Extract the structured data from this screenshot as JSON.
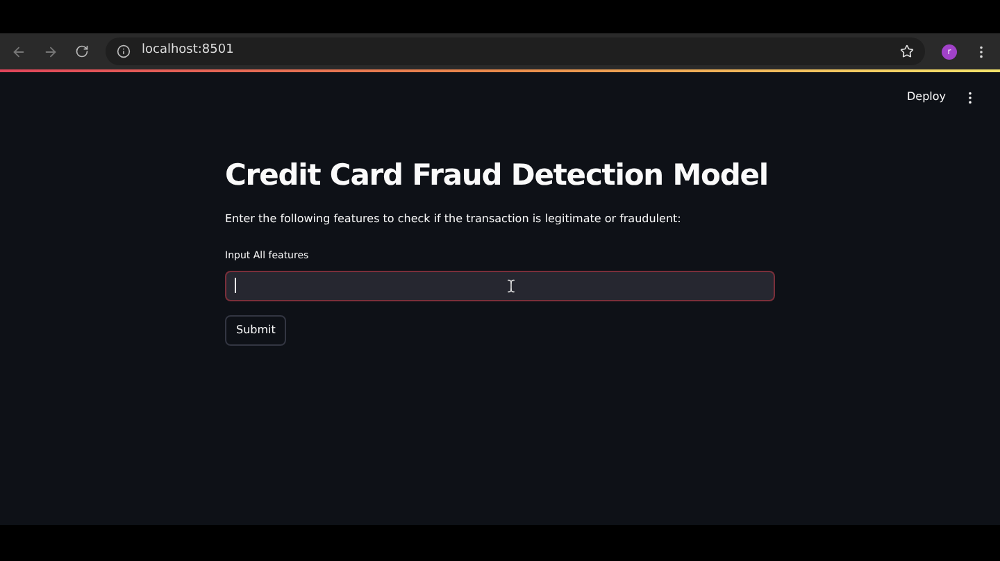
{
  "browser": {
    "url": "localhost:8501",
    "avatar": "r"
  },
  "header": {
    "deploy": "Deploy"
  },
  "main": {
    "title": "Credit Card Fraud Detection Model",
    "description": "Enter the following features to check if the transaction is legitimate or fraudulent:",
    "field": {
      "label": "Input All features",
      "focused": true
    },
    "button": "Submit"
  }
}
